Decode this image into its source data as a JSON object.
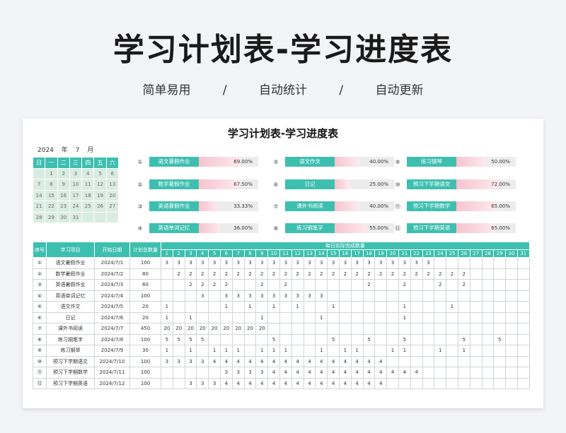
{
  "page": {
    "title": "学习计划表-学习进度表",
    "subtitle": [
      "简单易用",
      "/",
      "自动统计",
      "/",
      "自动更新"
    ]
  },
  "sheet": {
    "title": "学习计划表-学习进度表",
    "year": "2024",
    "year_label": "年",
    "month": "7",
    "month_label": "月",
    "weekdays": [
      "日",
      "一",
      "二",
      "三",
      "四",
      "五",
      "六"
    ],
    "calendar_rows": [
      [
        "",
        "1",
        "2",
        "3",
        "4",
        "5",
        "6"
      ],
      [
        "7",
        "8",
        "9",
        "10",
        "11",
        "12",
        "13"
      ],
      [
        "14",
        "15",
        "16",
        "17",
        "18",
        "19",
        "20"
      ],
      [
        "21",
        "22",
        "23",
        "24",
        "25",
        "26",
        "27"
      ],
      [
        "28",
        "29",
        "30",
        "31",
        "",
        "",
        ""
      ]
    ],
    "progress": [
      {
        "num": "①",
        "name": "语文暑假作业",
        "pct": "69.00%",
        "value": 0.69
      },
      {
        "num": "②",
        "name": "数学暑假作业",
        "pct": "67.50%",
        "value": 0.675
      },
      {
        "num": "③",
        "name": "英语暑假作业",
        "pct": "33.33%",
        "value": 0.3333
      },
      {
        "num": "④",
        "name": "英语单词记忆",
        "pct": "36.00%",
        "value": 0.36
      },
      {
        "num": "⑤",
        "name": "语文作文",
        "pct": "40.00%",
        "value": 0.4
      },
      {
        "num": "⑥",
        "name": "日记",
        "pct": "25.00%",
        "value": 0.25
      },
      {
        "num": "⑦",
        "name": "课外书阅读",
        "pct": "40.00%",
        "value": 0.4
      },
      {
        "num": "⑧",
        "name": "练习钢笔字",
        "pct": "55.00%",
        "value": 0.55
      },
      {
        "num": "⑨",
        "name": "练习钢琴",
        "pct": "50.00%",
        "value": 0.5
      },
      {
        "num": "⑩",
        "name": "预习下学期语文",
        "pct": "72.00%",
        "value": 0.72
      },
      {
        "num": "⑪",
        "name": "预习下学期数学",
        "pct": "65.00%",
        "value": 0.65
      },
      {
        "num": "⑫",
        "name": "预习下学期英语",
        "pct": "65.00%",
        "value": 0.65
      }
    ],
    "table": {
      "headers": {
        "seq": "序号",
        "item": "学习项目",
        "start": "开始日期",
        "total": "计划总数量",
        "daily": "每日实际完成数量"
      },
      "days": [
        "1",
        "2",
        "3",
        "4",
        "5",
        "6",
        "7",
        "8",
        "9",
        "10",
        "11",
        "12",
        "13",
        "14",
        "15",
        "16",
        "17",
        "18",
        "19",
        "20",
        "21",
        "22",
        "23",
        "24",
        "25",
        "26",
        "27",
        "28",
        "29",
        "30",
        "31"
      ],
      "rows": [
        {
          "seq": "①",
          "item": "语文暑假作业",
          "start": "2024/7/1",
          "total": "100",
          "daily": [
            "3",
            "3",
            "3",
            "3",
            "3",
            "3",
            "3",
            "3",
            "3",
            "3",
            "3",
            "3",
            "3",
            "3",
            "3",
            "3",
            "3",
            "3",
            "3",
            "3",
            "3",
            "3",
            "3",
            "",
            "",
            "",
            "",
            "",
            "",
            "",
            ""
          ]
        },
        {
          "seq": "②",
          "item": "数学暑假作业",
          "start": "2024/7/2",
          "total": "80",
          "daily": [
            "",
            "2",
            "2",
            "2",
            "2",
            "2",
            "2",
            "2",
            "2",
            "2",
            "2",
            "2",
            "2",
            "2",
            "2",
            "2",
            "2",
            "2",
            "2",
            "2",
            "2",
            "2",
            "2",
            "2",
            "2",
            "2",
            "",
            "",
            "",
            "",
            ""
          ]
        },
        {
          "seq": "③",
          "item": "英语暑假作业",
          "start": "2024/7/3",
          "total": "60",
          "daily": [
            "",
            "",
            "2",
            "2",
            "2",
            "2",
            "",
            "",
            "2",
            "",
            "2",
            "",
            "",
            "",
            "",
            "",
            "",
            "2",
            "",
            "",
            "2",
            "",
            "",
            "2",
            "",
            "2",
            "",
            "",
            "",
            "",
            ""
          ]
        },
        {
          "seq": "④",
          "item": "英语单词记忆",
          "start": "2024/7/4",
          "total": "100",
          "daily": [
            "",
            "",
            "",
            "3",
            "",
            "3",
            "3",
            "3",
            "3",
            "3",
            "3",
            "3",
            "3",
            "3",
            "",
            "",
            "",
            "",
            "",
            "",
            "",
            "",
            "",
            "",
            "",
            "",
            "",
            "",
            "",
            "",
            ""
          ]
        },
        {
          "seq": "⑤",
          "item": "语文作文",
          "start": "2024/7/5",
          "total": "20",
          "daily": [
            "1",
            "",
            "",
            "",
            "",
            "1",
            "",
            "1",
            "",
            "1",
            "",
            "1",
            "",
            "",
            "1",
            "",
            "",
            "",
            "",
            "",
            "1",
            "",
            "",
            "",
            "1",
            "",
            "",
            "",
            "",
            "",
            ""
          ]
        },
        {
          "seq": "⑥",
          "item": "日记",
          "start": "2024/7/6",
          "total": "20",
          "daily": [
            "1",
            "",
            "1",
            "",
            "",
            "",
            "",
            "",
            "1",
            "",
            "",
            "",
            "",
            "1",
            "",
            "",
            "",
            "",
            "",
            "",
            "1",
            "",
            "",
            "",
            "",
            "",
            "",
            "",
            "",
            "",
            ""
          ]
        },
        {
          "seq": "⑦",
          "item": "课外书阅读",
          "start": "2024/7/7",
          "total": "450",
          "daily": [
            "20",
            "20",
            "20",
            "20",
            "20",
            "20",
            "20",
            "20",
            "20",
            "",
            "",
            "",
            "",
            "",
            "",
            "",
            "",
            "",
            "",
            "",
            "",
            "",
            "",
            "",
            "",
            "",
            "",
            "",
            "",
            "",
            ""
          ]
        },
        {
          "seq": "⑧",
          "item": "练习钢笔字",
          "start": "2024/7/8",
          "total": "100",
          "daily": [
            "5",
            "5",
            "5",
            "5",
            "",
            "",
            "",
            "",
            "",
            "5",
            "",
            "",
            "",
            "",
            "5",
            "",
            "",
            "5",
            "",
            "",
            "5",
            "",
            "",
            "",
            "",
            "5",
            "",
            "",
            "5",
            "",
            ""
          ]
        },
        {
          "seq": "⑨",
          "item": "练习钢琴",
          "start": "2024/7/9",
          "total": "30",
          "daily": [
            "1",
            "",
            "1",
            "",
            "1",
            "1",
            "1",
            "",
            "1",
            "1",
            "1",
            "",
            "",
            "1",
            "",
            "1",
            "1",
            "",
            "",
            "1",
            "1",
            "",
            "",
            "1",
            "",
            "1",
            "",
            "",
            "",
            "",
            ""
          ]
        },
        {
          "seq": "⑩",
          "item": "预习下学期语文",
          "start": "2024/7/10",
          "total": "100",
          "daily": [
            "3",
            "3",
            "3",
            "3",
            "4",
            "4",
            "4",
            "4",
            "4",
            "4",
            "4",
            "4",
            "4",
            "4",
            "4",
            "4",
            "4",
            "4",
            "4",
            "",
            "",
            "",
            "",
            "",
            "",
            "",
            "",
            "",
            "",
            "",
            ""
          ]
        },
        {
          "seq": "⑪",
          "item": "预习下学期数学",
          "start": "2024/7/11",
          "total": "100",
          "daily": [
            "",
            "",
            "",
            "",
            "",
            "3",
            "3",
            "3",
            "3",
            "4",
            "4",
            "4",
            "4",
            "4",
            "4",
            "4",
            "4",
            "4",
            "4",
            "4",
            "4",
            "4",
            "",
            "",
            "",
            "",
            "",
            "",
            "",
            "",
            ""
          ]
        },
        {
          "seq": "⑫",
          "item": "预习下学期英语",
          "start": "2024/7/12",
          "total": "100",
          "daily": [
            "",
            "",
            "3",
            "3",
            "3",
            "4",
            "4",
            "4",
            "4",
            "4",
            "4",
            "4",
            "4",
            "4",
            "4",
            "4",
            "4",
            "4",
            "4",
            "",
            "",
            "",
            "",
            "",
            "",
            "",
            "",
            "",
            "",
            "",
            ""
          ]
        }
      ]
    }
  },
  "colors": {
    "accent": "#3dbfb0",
    "calendar_bg": "#d9ece2",
    "bar": "#f6c4cf"
  }
}
